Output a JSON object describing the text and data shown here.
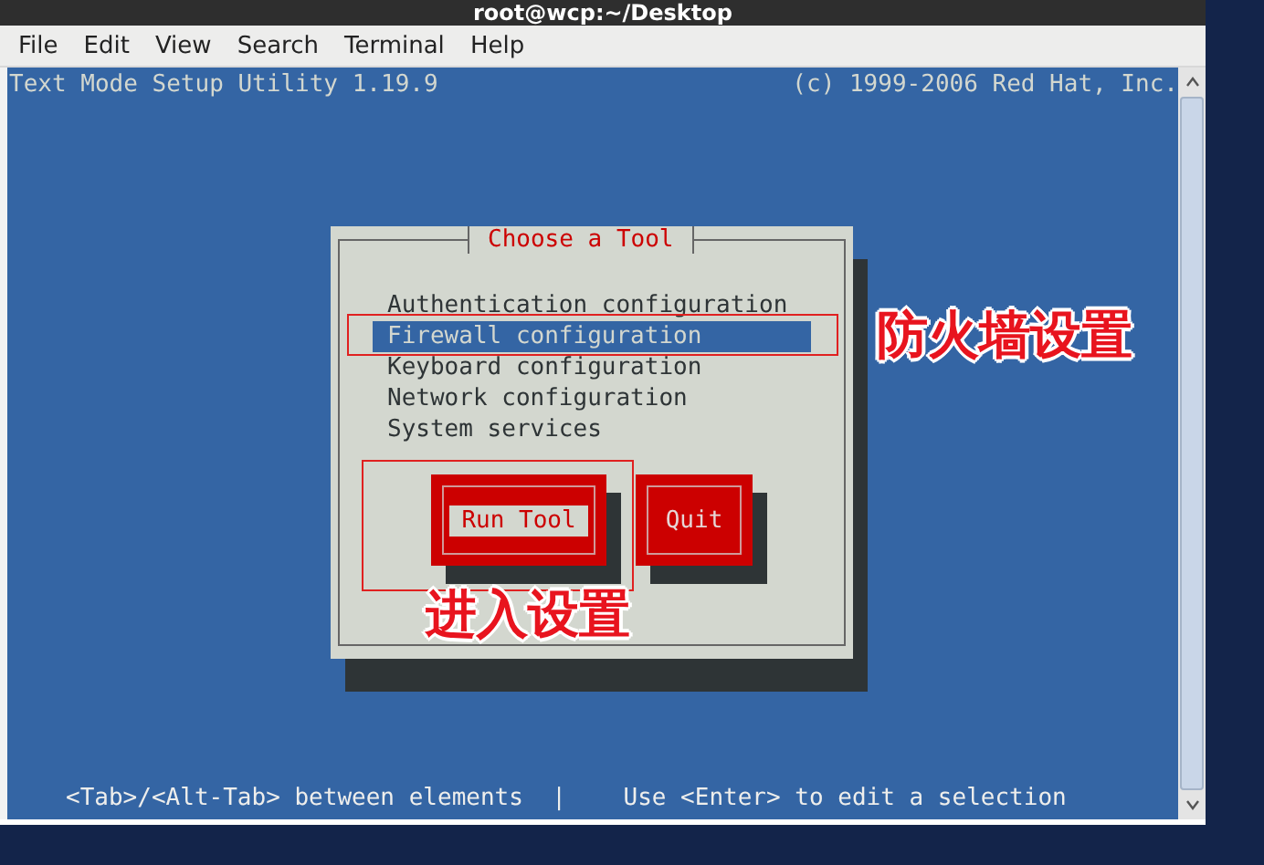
{
  "window": {
    "title": "root@wcp:~/Desktop"
  },
  "menu": [
    "File",
    "Edit",
    "View",
    "Search",
    "Terminal",
    "Help"
  ],
  "terminal": {
    "header_left": "Text Mode Setup Utility 1.19.9",
    "header_right": "(c) 1999-2006 Red Hat, Inc.",
    "dialog": {
      "title": "Choose a Tool",
      "items": [
        {
          "label": "Authentication configuration",
          "selected": false
        },
        {
          "label": "Firewall configuration",
          "selected": true
        },
        {
          "label": "Keyboard configuration",
          "selected": false
        },
        {
          "label": "Network configuration",
          "selected": false
        },
        {
          "label": "System services",
          "selected": false
        }
      ],
      "buttons": [
        {
          "label": "Run Tool",
          "selected": true
        },
        {
          "label": "Quit",
          "selected": false
        }
      ]
    },
    "footer": "<Tab>/<Alt-Tab> between elements  |    Use <Enter> to edit a selection"
  },
  "annotations": {
    "list_note": "防火墙设置",
    "button_note": "进入设置"
  }
}
